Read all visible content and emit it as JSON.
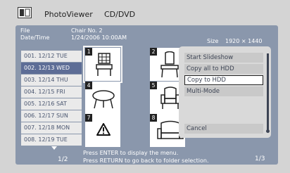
{
  "header": {
    "app_name": "PhotoViewer",
    "source": "CD/DVD"
  },
  "info": {
    "file_label": "File",
    "file_value": "Chair No. 2",
    "datetime_label": "Date/Time",
    "datetime_value": "1/24/2006 10:00AM",
    "size_label": "Size",
    "size_value": "1920 × 1440"
  },
  "list": {
    "items": [
      "001. 12/12 TUE",
      "002. 12/13 WED",
      "003. 12/14 THU",
      "004. 12/15 FRI",
      "005. 12/16 SAT",
      "006. 12/17 SUN",
      "007. 12/18 MON",
      "008. 12/19 TUE"
    ],
    "selected_index": 1,
    "page": "1/2"
  },
  "thumbnails": [
    {
      "number": "1",
      "icon": "grid-chair-icon"
    },
    {
      "number": "2",
      "icon": "chair-icon"
    },
    {
      "number": "4",
      "icon": "table-icon"
    },
    {
      "number": "5",
      "icon": "armchair-icon"
    },
    {
      "number": "7",
      "icon": "warning-icon"
    },
    {
      "number": "8",
      "icon": "sofa-icon"
    }
  ],
  "menu": {
    "items": [
      "Start Slideshow",
      "Copy all to HDD",
      "Copy to HDD",
      "Multi-Mode",
      "Cancel"
    ],
    "active_index": 2
  },
  "help": {
    "line1": "Press ENTER to display the menu.",
    "line2": "Press RETURN to go back to folder selection."
  },
  "thumb_page": "1/3"
}
